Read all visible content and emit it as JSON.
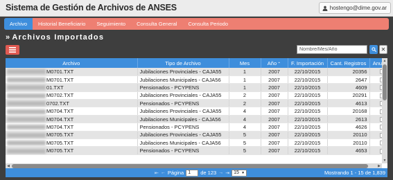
{
  "app": {
    "title": "Sistema de Gestión de Archivos de ANSES",
    "user": "hostengo@dime.gov.ar"
  },
  "nav": {
    "items": [
      {
        "label": "Archivo",
        "active": true
      },
      {
        "label": "Historial Beneficiario",
        "active": false
      },
      {
        "label": "Seguimiento",
        "active": false
      },
      {
        "label": "Consulta General",
        "active": false
      },
      {
        "label": "Consulta Periodo",
        "active": false
      }
    ]
  },
  "section": {
    "title": "Archivos Importados",
    "bullet": "»"
  },
  "filter": {
    "placeholder": "Nombre/Mes/Año",
    "value": ""
  },
  "table": {
    "columns": [
      "Archivo",
      "Tipo de Archivo",
      "Mes",
      "Año",
      "F. Importación",
      "Cant. Registros",
      "Anulado"
    ],
    "rows": [
      {
        "archivo": "M0701.TXT",
        "tipo": "Jubilaciones Provinciales - CAJA55",
        "mes": "1",
        "anio": "2007",
        "fecha": "22/10/2015",
        "registros": "20356"
      },
      {
        "archivo": "M0701.TXT",
        "tipo": "Jubilaciones Municipales - CAJA56",
        "mes": "1",
        "anio": "2007",
        "fecha": "22/10/2015",
        "registros": "2647"
      },
      {
        "archivo": "01.TXT",
        "tipo": "Pensionados - PCYPENS",
        "mes": "1",
        "anio": "2007",
        "fecha": "22/10/2015",
        "registros": "4609"
      },
      {
        "archivo": "M0702.TXT",
        "tipo": "Jubilaciones Provinciales - CAJA55",
        "mes": "2",
        "anio": "2007",
        "fecha": "22/10/2015",
        "registros": "20291"
      },
      {
        "archivo": "0702.TXT",
        "tipo": "Pensionados - PCYPENS",
        "mes": "2",
        "anio": "2007",
        "fecha": "22/10/2015",
        "registros": "4613"
      },
      {
        "archivo": "M0704.TXT",
        "tipo": "Jubilaciones Provinciales - CAJA55",
        "mes": "4",
        "anio": "2007",
        "fecha": "22/10/2015",
        "registros": "20168"
      },
      {
        "archivo": "M0704.TXT",
        "tipo": "Jubilaciones Municipales - CAJA56",
        "mes": "4",
        "anio": "2007",
        "fecha": "22/10/2015",
        "registros": "2613"
      },
      {
        "archivo": "M0704.TXT",
        "tipo": "Pensionados - PCYPENS",
        "mes": "4",
        "anio": "2007",
        "fecha": "22/10/2015",
        "registros": "4626"
      },
      {
        "archivo": "M0705.TXT",
        "tipo": "Jubilaciones Provinciales - CAJA55",
        "mes": "5",
        "anio": "2007",
        "fecha": "22/10/2015",
        "registros": "20110"
      },
      {
        "archivo": "M0705.TXT",
        "tipo": "Jubilaciones Municipales - CAJA56",
        "mes": "5",
        "anio": "2007",
        "fecha": "22/10/2015",
        "registros": "20110"
      },
      {
        "archivo": "M0705.TXT",
        "tipo": "Pensionados - PCYPENS",
        "mes": "5",
        "anio": "2007",
        "fecha": "22/10/2015",
        "registros": "4653"
      }
    ]
  },
  "pager": {
    "page_label": "Página",
    "page_value": "1",
    "of_label": "de 123",
    "rows_per_page": "15",
    "info": "Mostrando 1 - 15 de 1,839"
  },
  "colors": {
    "accent": "#3e8edc",
    "nav": "#ee7f72",
    "danger": "#e05a52",
    "background": "#3e3e3e"
  },
  "icons": {
    "user": "user-icon",
    "menu": "list-icon",
    "filter": "filter-search-icon",
    "clear": "close-icon",
    "sort": "sort-asc-icon"
  }
}
